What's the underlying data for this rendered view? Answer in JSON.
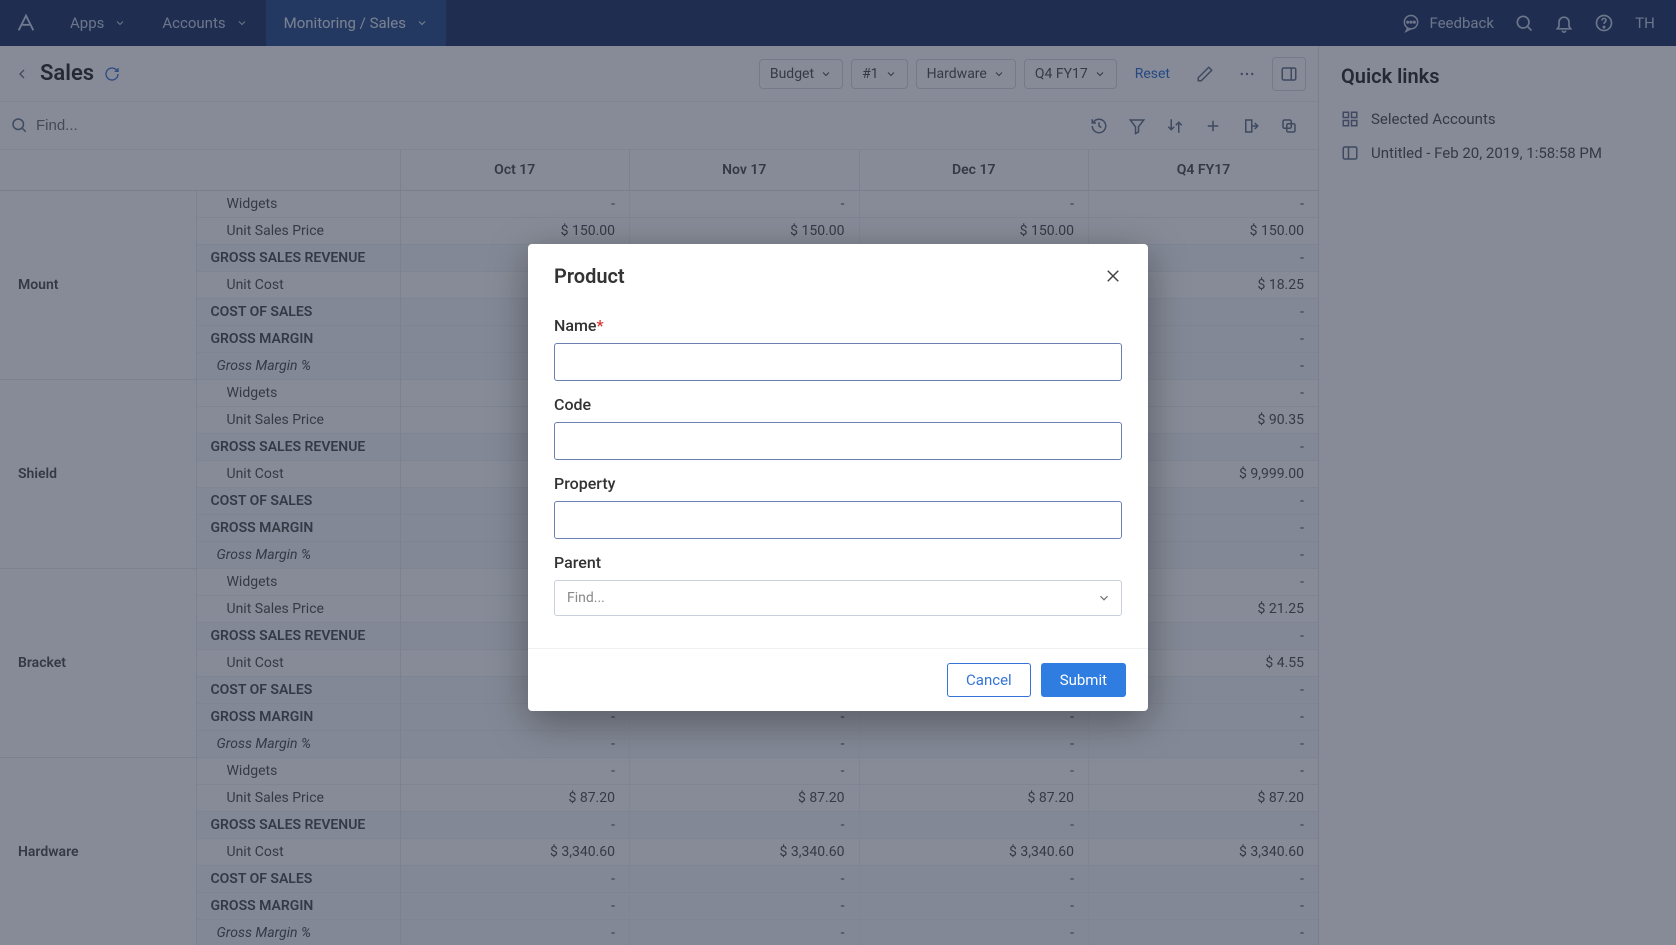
{
  "topnav": {
    "apps": "Apps",
    "accounts": "Accounts",
    "monitoring": "Monitoring / Sales",
    "feedback": "Feedback",
    "avatar": "TH"
  },
  "page": {
    "title": "Sales",
    "reset": "Reset",
    "search_placeholder": "Find...",
    "chips": [
      "Budget",
      "#1",
      "Hardware",
      "Q4 FY17"
    ]
  },
  "side": {
    "heading": "Quick links",
    "links": [
      "Selected Accounts",
      "Untitled - Feb 20, 2019, 1:58:58 PM"
    ]
  },
  "table": {
    "columns": [
      "Oct 17",
      "Nov 17",
      "Dec 17",
      "Q4 FY17"
    ],
    "groups": [
      {
        "category": "Mount",
        "rows": [
          {
            "label": "Widgets",
            "indent": 2,
            "vals": [
              "-",
              "-",
              "-",
              "-"
            ]
          },
          {
            "label": "Unit Sales Price",
            "indent": 2,
            "vals": [
              "$ 150.00",
              "$ 150.00",
              "$ 150.00",
              "$ 150.00"
            ]
          },
          {
            "label": "GROSS SALES REVENUE",
            "indent": 1,
            "section": true,
            "vals": [
              "-",
              "-",
              "-",
              "-"
            ]
          },
          {
            "label": "Unit Cost",
            "indent": 2,
            "vals": [
              "-",
              "-",
              "-",
              "$ 18.25"
            ]
          },
          {
            "label": "COST OF SALES",
            "indent": 1,
            "section": true,
            "vals": [
              "-",
              "-",
              "-",
              "-"
            ]
          },
          {
            "label": "GROSS MARGIN",
            "indent": 1,
            "section": true,
            "vals": [
              "-",
              "-",
              "-",
              "-"
            ]
          },
          {
            "label": "Gross Margin %",
            "italic": true,
            "section": true,
            "vals": [
              "-",
              "-",
              "-",
              "-"
            ]
          }
        ]
      },
      {
        "category": "Shield",
        "rows": [
          {
            "label": "Widgets",
            "indent": 2,
            "vals": [
              "-",
              "-",
              "-",
              "-"
            ]
          },
          {
            "label": "Unit Sales Price",
            "indent": 2,
            "vals": [
              "-",
              "-",
              "-",
              "$ 90.35"
            ]
          },
          {
            "label": "GROSS SALES REVENUE",
            "indent": 1,
            "section": true,
            "vals": [
              "-",
              "-",
              "-",
              "-"
            ]
          },
          {
            "label": "Unit Cost",
            "indent": 2,
            "vals": [
              "-",
              "-",
              "-",
              "$ 9,999.00"
            ]
          },
          {
            "label": "COST OF SALES",
            "indent": 1,
            "section": true,
            "vals": [
              "-",
              "-",
              "-",
              "-"
            ]
          },
          {
            "label": "GROSS MARGIN",
            "indent": 1,
            "section": true,
            "vals": [
              "-",
              "-",
              "-",
              "-"
            ]
          },
          {
            "label": "Gross Margin %",
            "italic": true,
            "section": true,
            "vals": [
              "-",
              "-",
              "-",
              "-"
            ]
          }
        ]
      },
      {
        "category": "Bracket",
        "rows": [
          {
            "label": "Widgets",
            "indent": 2,
            "vals": [
              "-",
              "-",
              "-",
              "-"
            ]
          },
          {
            "label": "Unit Sales Price",
            "indent": 2,
            "vals": [
              "-",
              "-",
              "-",
              "$ 21.25"
            ]
          },
          {
            "label": "GROSS SALES REVENUE",
            "indent": 1,
            "section": true,
            "vals": [
              "-",
              "-",
              "-",
              "-"
            ]
          },
          {
            "label": "Unit Cost",
            "indent": 2,
            "vals": [
              "-",
              "-",
              "-",
              "$ 4.55"
            ]
          },
          {
            "label": "COST OF SALES",
            "indent": 1,
            "section": true,
            "vals": [
              "-",
              "-",
              "-",
              "-"
            ]
          },
          {
            "label": "GROSS MARGIN",
            "indent": 1,
            "section": true,
            "vals": [
              "-",
              "-",
              "-",
              "-"
            ]
          },
          {
            "label": "Gross Margin %",
            "italic": true,
            "section": true,
            "vals": [
              "-",
              "-",
              "-",
              "-"
            ]
          }
        ]
      },
      {
        "category": "Hardware",
        "rows": [
          {
            "label": "Widgets",
            "indent": 2,
            "vals": [
              "-",
              "-",
              "-",
              "-"
            ]
          },
          {
            "label": "Unit Sales Price",
            "indent": 2,
            "vals": [
              "$ 87.20",
              "$ 87.20",
              "$ 87.20",
              "$ 87.20"
            ]
          },
          {
            "label": "GROSS SALES REVENUE",
            "indent": 1,
            "section": true,
            "vals": [
              "-",
              "-",
              "-",
              "-"
            ]
          },
          {
            "label": "Unit Cost",
            "indent": 2,
            "vals": [
              "$ 3,340.60",
              "$ 3,340.60",
              "$ 3,340.60",
              "$ 3,340.60"
            ]
          },
          {
            "label": "COST OF SALES",
            "indent": 1,
            "section": true,
            "vals": [
              "-",
              "-",
              "-",
              "-"
            ]
          },
          {
            "label": "GROSS MARGIN",
            "indent": 1,
            "section": true,
            "vals": [
              "-",
              "-",
              "-",
              "-"
            ]
          },
          {
            "label": "Gross Margin %",
            "italic": true,
            "section": true,
            "vals": [
              "-",
              "-",
              "-",
              "-"
            ]
          }
        ]
      }
    ]
  },
  "modal": {
    "title": "Product",
    "name_label": "Name",
    "code_label": "Code",
    "property_label": "Property",
    "parent_label": "Parent",
    "parent_placeholder": "Find...",
    "cancel": "Cancel",
    "submit": "Submit"
  }
}
